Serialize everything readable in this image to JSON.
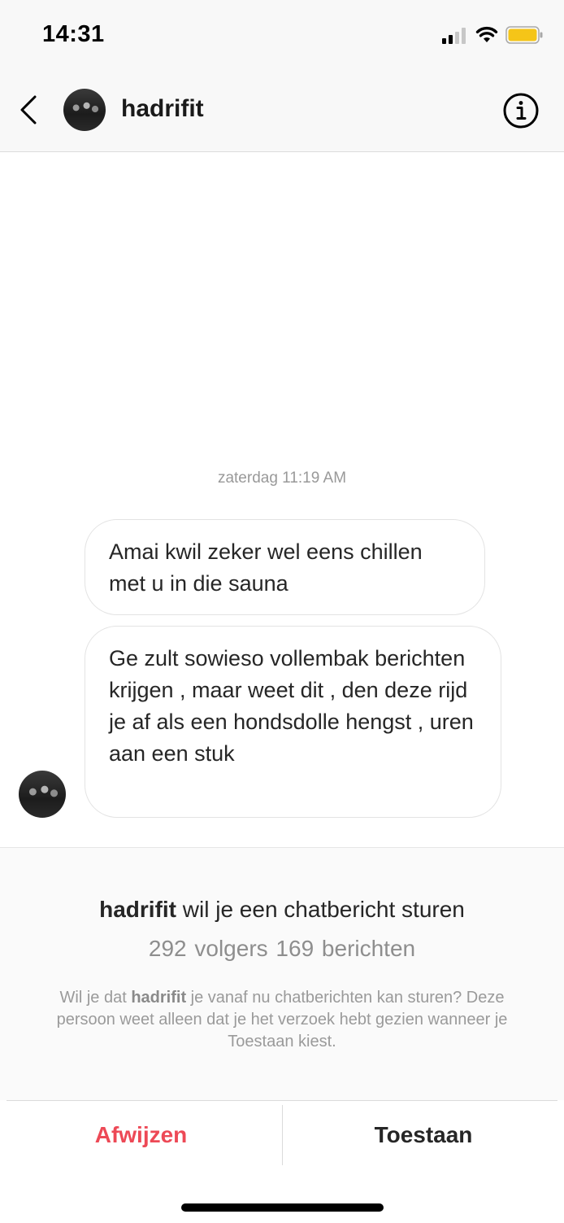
{
  "status_bar": {
    "time": "14:31",
    "signal_icon": "cellular-signal-icon",
    "wifi_icon": "wifi-icon",
    "battery_icon": "battery-icon",
    "battery_color": "#f5c518"
  },
  "header": {
    "back_icon": "chevron-left-icon",
    "username": "hadrifit",
    "info_icon": "info-icon"
  },
  "conversation": {
    "timestamp": "zaterdag 11:19 AM",
    "messages": [
      {
        "text": "Amai kwil zeker wel eens chillen met u in die sauna"
      },
      {
        "text": "Ge zult sowieso vollembak berichten krijgen , maar weet dit , den deze rijd je af als een hondsdolle hengst , uren aan een stuk"
      }
    ]
  },
  "request": {
    "username": "hadrifit",
    "title_suffix": " wil je een chatbericht sturen",
    "stats": "292 volgers  169 berichten",
    "desc_prefix": "Wil je dat ",
    "desc_username": "hadrifit",
    "desc_suffix": " je vanaf nu chatberichten kan sturen? Deze persoon weet alleen dat je het verzoek hebt gezien wanneer je Toestaan kiest.",
    "decline_label": "Afwijzen",
    "accept_label": "Toestaan",
    "decline_color": "#ed4956"
  }
}
